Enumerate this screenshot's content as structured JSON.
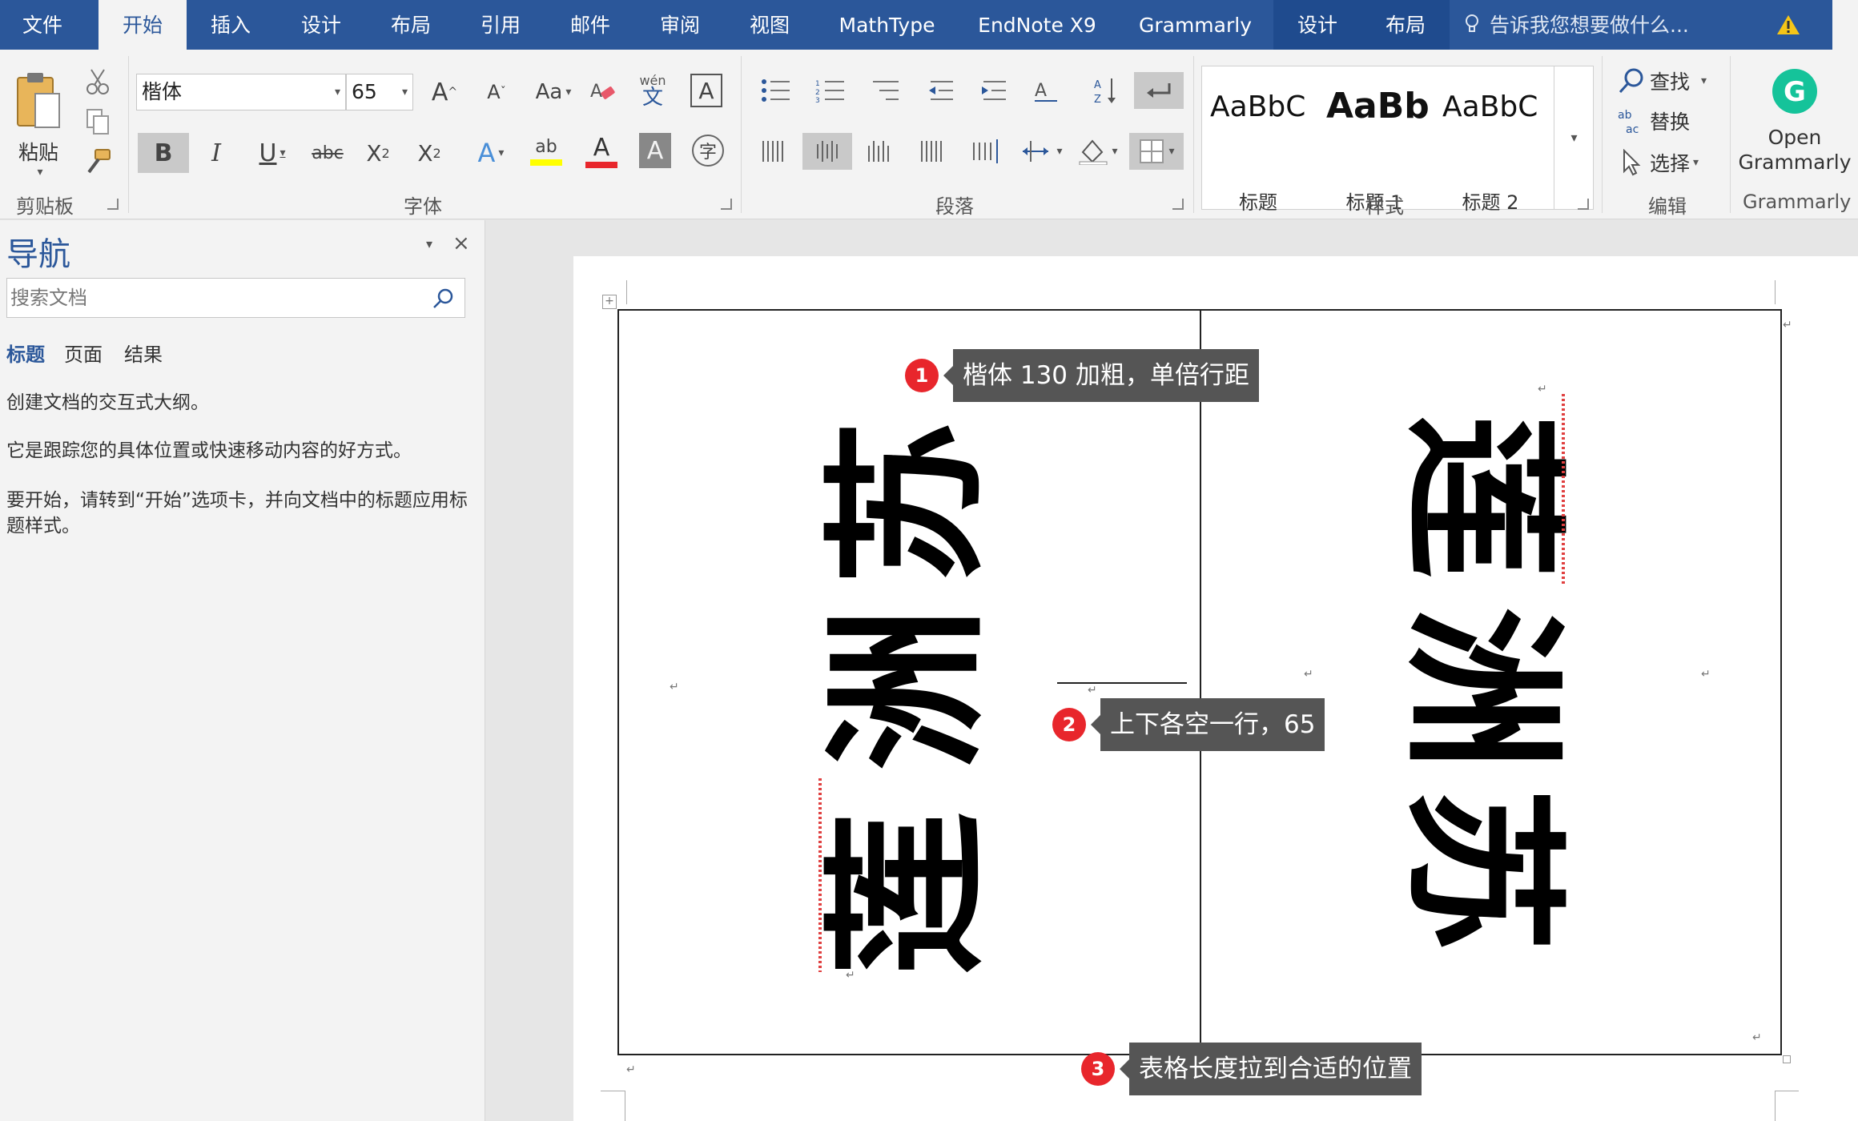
{
  "tabs": [
    {
      "label": "文件"
    },
    {
      "label": "开始"
    },
    {
      "label": "插入"
    },
    {
      "label": "设计"
    },
    {
      "label": "布局"
    },
    {
      "label": "引用"
    },
    {
      "label": "邮件"
    },
    {
      "label": "审阅"
    },
    {
      "label": "视图"
    },
    {
      "label": "MathType"
    },
    {
      "label": "EndNote X9"
    },
    {
      "label": "Grammarly"
    },
    {
      "label": "设计"
    },
    {
      "label": "布局"
    }
  ],
  "active_tab": "开始",
  "tell_me": "告诉我您想要做什么...",
  "clipboard": {
    "paste_label": "粘贴",
    "group_label": "剪贴板"
  },
  "font": {
    "name": "楷体",
    "size": "65",
    "group_label": "字体",
    "btn_grow": "A",
    "btn_shrink": "A",
    "btn_case": "Aa",
    "btn_phonetic_top": "wén",
    "btn_phonetic_bottom": "文",
    "btn_border_char": "A",
    "btn_bold": "B",
    "btn_italic": "I",
    "btn_underline": "U",
    "btn_strike": "abc",
    "btn_sub": "X",
    "btn_sub_mark": "2",
    "btn_sup": "X",
    "btn_sup_mark": "2",
    "btn_effects": "A",
    "btn_highlight": "ab",
    "btn_color": "A",
    "btn_shade": "A",
    "btn_enclose": "字",
    "highlight_color": "#ffff00",
    "font_color": "#e8262c"
  },
  "paragraph": {
    "group_label": "段落"
  },
  "styles": {
    "group_label": "样式",
    "items": [
      {
        "preview": "AaBbC",
        "name": "标题"
      },
      {
        "preview": "AaBb",
        "name": "标题 1"
      },
      {
        "preview": "AaBbC",
        "name": "标题 2"
      }
    ]
  },
  "editing": {
    "find": "查找",
    "replace": "替换",
    "select": "选择",
    "group_label": "编辑"
  },
  "grammarly": {
    "button": "Open Grammarly",
    "group_label": "Grammarly",
    "brand_color": "#15c39a"
  },
  "nav": {
    "title": "导航",
    "search_placeholder": "搜索文档",
    "tabs": [
      "标题",
      "页面",
      "结果"
    ],
    "text1": "创建文档的交互式大纲。",
    "text2": "它是跟踪您的具体位置或快速移动内容的好方式。",
    "text3": "要开始，请转到“开始”选项卡，并向文档中的标题应用标题样式。"
  },
  "document": {
    "left_chars": [
      "苏",
      "洲",
      "莲"
    ],
    "right_chars": [
      "莲",
      "洲",
      "苏"
    ]
  },
  "callouts": [
    {
      "num": "1",
      "text": "楷体 130 加粗，单倍行距"
    },
    {
      "num": "2",
      "text": "上下各空一行，65"
    },
    {
      "num": "3",
      "text": "表格长度拉到合适的位置"
    }
  ],
  "colors": {
    "ribbon_blue": "#2b579a",
    "callout_bg": "#555555",
    "badge_red": "#e8262c"
  }
}
